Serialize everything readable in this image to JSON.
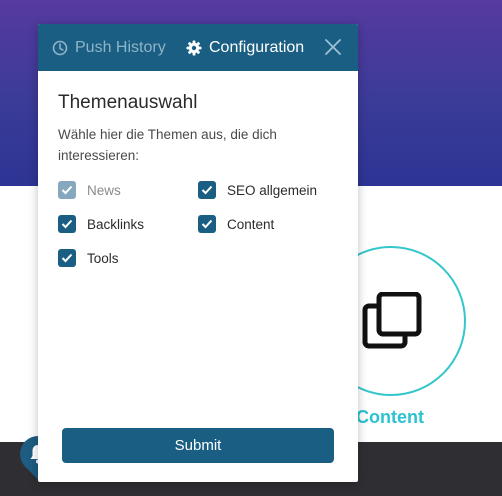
{
  "popup": {
    "tabs": {
      "history": "Push History",
      "configuration": "Configuration"
    },
    "title": "Themenauswahl",
    "description": "Wähle hier die Themen aus, die dich interessieren:",
    "topics": [
      {
        "label": "News",
        "checked": true,
        "disabled": true
      },
      {
        "label": "SEO allgemein",
        "checked": true,
        "disabled": false
      },
      {
        "label": "Backlinks",
        "checked": true,
        "disabled": false
      },
      {
        "label": "Content",
        "checked": true,
        "disabled": false
      },
      {
        "label": "Tools",
        "checked": true,
        "disabled": false
      }
    ],
    "submit_label": "Submit"
  },
  "background": {
    "card_title": "Content"
  },
  "colors": {
    "accent": "#1a5f83",
    "disabled_checkbox": "#86a8bf",
    "teal": "#2bc3cf",
    "header_gradient_top": "#563a9f",
    "header_gradient_bottom": "#2d3494",
    "footer": "#2f2f33"
  },
  "icons": {
    "history": "clock-icon",
    "configuration": "gear-icon",
    "close": "close-icon",
    "checkbox": "checkmark-icon",
    "card": "copy-icon",
    "notifications": "bell-icon"
  }
}
